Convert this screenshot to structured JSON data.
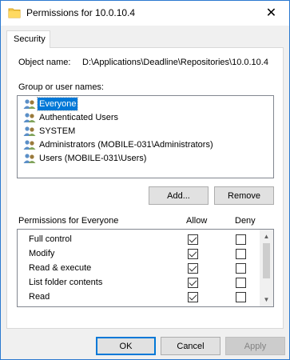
{
  "window": {
    "title": "Permissions for 10.0.10.4",
    "close_glyph": "✕"
  },
  "tabs": [
    {
      "label": "Security"
    }
  ],
  "object": {
    "label": "Object name:",
    "value": "D:\\Applications\\Deadline\\Repositories\\10.0.10.4"
  },
  "groups": {
    "label": "Group or user names:",
    "items": [
      {
        "label": "Everyone",
        "selected": true,
        "icon": "users-icon"
      },
      {
        "label": "Authenticated Users",
        "selected": false,
        "icon": "users-icon"
      },
      {
        "label": "SYSTEM",
        "selected": false,
        "icon": "users-icon"
      },
      {
        "label": "Administrators (MOBILE-031\\Administrators)",
        "selected": false,
        "icon": "users-icon"
      },
      {
        "label": "Users (MOBILE-031\\Users)",
        "selected": false,
        "icon": "users-icon"
      }
    ]
  },
  "buttons": {
    "add": "Add...",
    "remove": "Remove",
    "ok": "OK",
    "cancel": "Cancel",
    "apply": "Apply"
  },
  "permissions": {
    "label": "Permissions for Everyone",
    "allow_header": "Allow",
    "deny_header": "Deny",
    "rows": [
      {
        "name": "Full control",
        "allow": true,
        "deny": false
      },
      {
        "name": "Modify",
        "allow": true,
        "deny": false
      },
      {
        "name": "Read & execute",
        "allow": true,
        "deny": false
      },
      {
        "name": "List folder contents",
        "allow": true,
        "deny": false
      },
      {
        "name": "Read",
        "allow": true,
        "deny": false
      },
      {
        "name": "",
        "allow": true,
        "deny": false
      }
    ]
  },
  "colors": {
    "selection": "#0078d7",
    "window_border": "#2b79d0"
  }
}
